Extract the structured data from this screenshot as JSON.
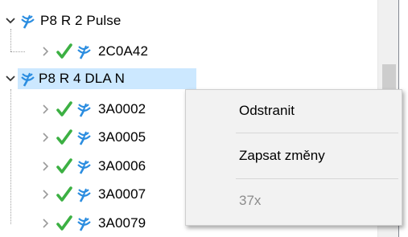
{
  "tree": {
    "items": [
      {
        "label": "P8 R 2 Pulse",
        "state": "expanded",
        "status": "",
        "icon": "antenna-icon"
      },
      {
        "label": "2C0A42",
        "state": "collapsed",
        "status": "ok-check",
        "icon": "antenna-icon"
      },
      {
        "label": "P8 R 4 DLA N",
        "state": "expanded",
        "status": "",
        "icon": "antenna-icon",
        "selected": true
      },
      {
        "label": "3A0002",
        "state": "collapsed",
        "status": "ok-check",
        "icon": "antenna-icon"
      },
      {
        "label": "3A0005",
        "state": "collapsed",
        "status": "ok-check",
        "icon": "antenna-icon"
      },
      {
        "label": "3A0006",
        "state": "collapsed",
        "status": "ok-check",
        "icon": "antenna-icon"
      },
      {
        "label": "3A0007",
        "state": "collapsed",
        "status": "ok-check",
        "icon": "antenna-icon"
      },
      {
        "label": "3A0079",
        "state": "collapsed",
        "status": "ok-check",
        "icon": "antenna-icon"
      }
    ]
  },
  "context_menu": {
    "items": [
      {
        "label": "Odstranit",
        "enabled": true
      },
      {
        "label": "Zapsat změny",
        "enabled": true
      },
      {
        "label": "37x",
        "enabled": false
      }
    ]
  },
  "colors": {
    "selection": "#cce8ff",
    "check": "#3cb043",
    "antenna": "#2b8de0",
    "menu_bg": "#f2f2f2"
  }
}
